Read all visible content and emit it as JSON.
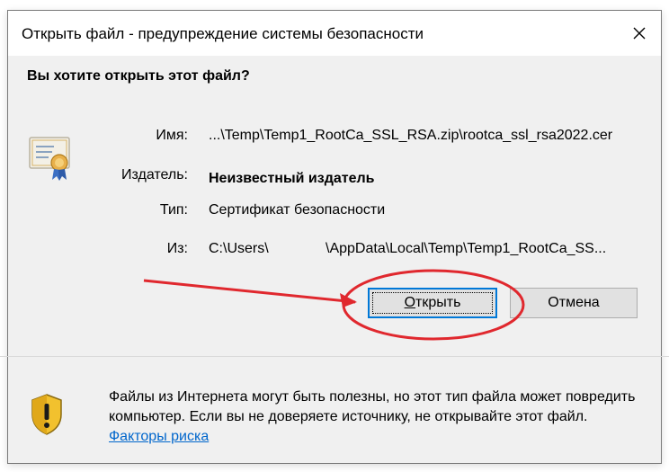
{
  "dialog": {
    "title": "Открыть файл - предупреждение системы безопасности",
    "close_glyph": "✕",
    "question": "Вы хотите открыть этот файл?",
    "fields": {
      "name_label": "Имя:",
      "name_value": "...\\Temp\\Temp1_RootCa_SSL_RSA.zip\\rootca_ssl_rsa2022.cer",
      "publisher_label": "Издатель:",
      "publisher_value": "Неизвестный издатель",
      "type_label": "Тип:",
      "type_value": "Сертификат безопасности",
      "from_label": "Из:",
      "from_value_part1": "C:\\Users\\",
      "from_value_part2": "\\AppData\\Local\\Temp\\Temp1_RootCa_SS..."
    },
    "buttons": {
      "open_accel": "О",
      "open_rest": "ткрыть",
      "cancel": "Отмена"
    },
    "warning": {
      "text": "Файлы из Интернета могут быть полезны, но этот тип файла может повредить компьютер. Если вы не доверяете источнику, не открывайте этот файл.",
      "link": "Факторы риска"
    },
    "icons": {
      "file_icon": "certificate-icon",
      "warning_icon": "security-shield-icon",
      "close_icon": "close-icon"
    },
    "colors": {
      "annotation": "#e0282e",
      "accent": "#0078d7",
      "link": "#0066cc"
    }
  }
}
